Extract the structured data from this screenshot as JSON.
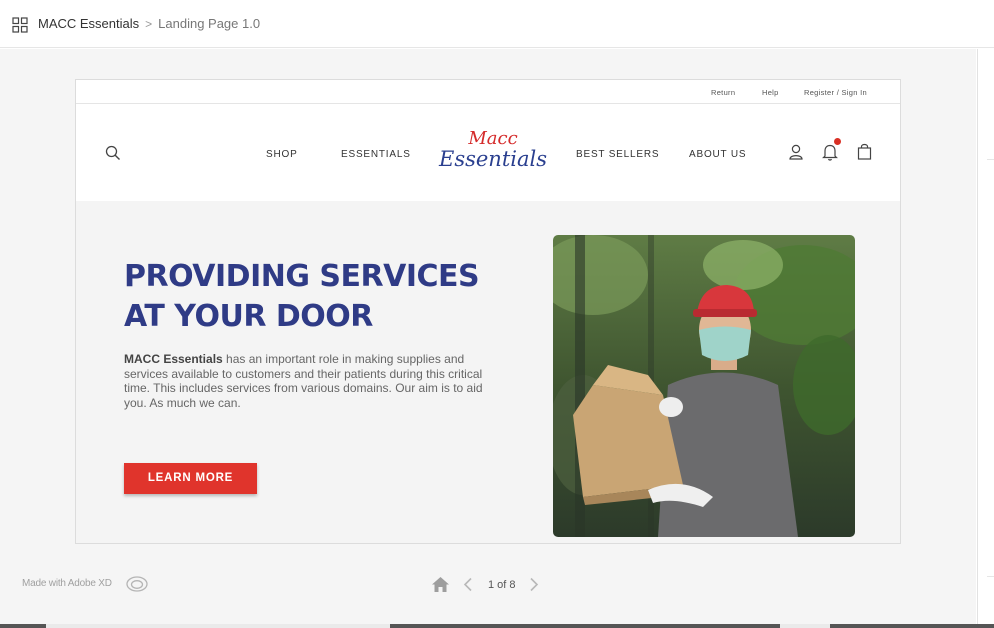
{
  "app": {
    "project_name": "MACC Essentials",
    "breadcrumb_sep": ">",
    "page_name": "Landing Page 1.0"
  },
  "site": {
    "utility": {
      "return": "Return",
      "help": "Help",
      "register": "Register / Sign In"
    },
    "nav": {
      "shop": "SHOP",
      "essentials": "ESSENTIALS",
      "best_sellers": "BEST SELLERS",
      "about": "ABOUT US"
    },
    "logo": {
      "line1": "Macc",
      "line2": "Essentials"
    },
    "hero": {
      "title_line1": "PROVIDING SERVICES",
      "title_line2": "AT YOUR DOOR",
      "body_bold": "MACC Essentials",
      "body_rest": " has an important role in making supplies and services available to customers and their patients during this critical time. This includes services from various domains. Our aim is to aid you. As much we can.",
      "cta": "LEARN MORE"
    }
  },
  "footer": {
    "made_with": "Made with Adobe XD",
    "pager": "1 of 8"
  },
  "colors": {
    "hero_title": "#2f3b86",
    "cta": "#e0342c",
    "logo_red": "#d42a2a",
    "logo_blue": "#2a3f8f",
    "notification_dot": "#d93025"
  },
  "icons": [
    "grid-icon",
    "search-icon",
    "user-icon",
    "bell-icon",
    "bag-icon",
    "creative-cloud-icon",
    "home-icon",
    "chevron-left-icon",
    "chevron-right-icon"
  ]
}
